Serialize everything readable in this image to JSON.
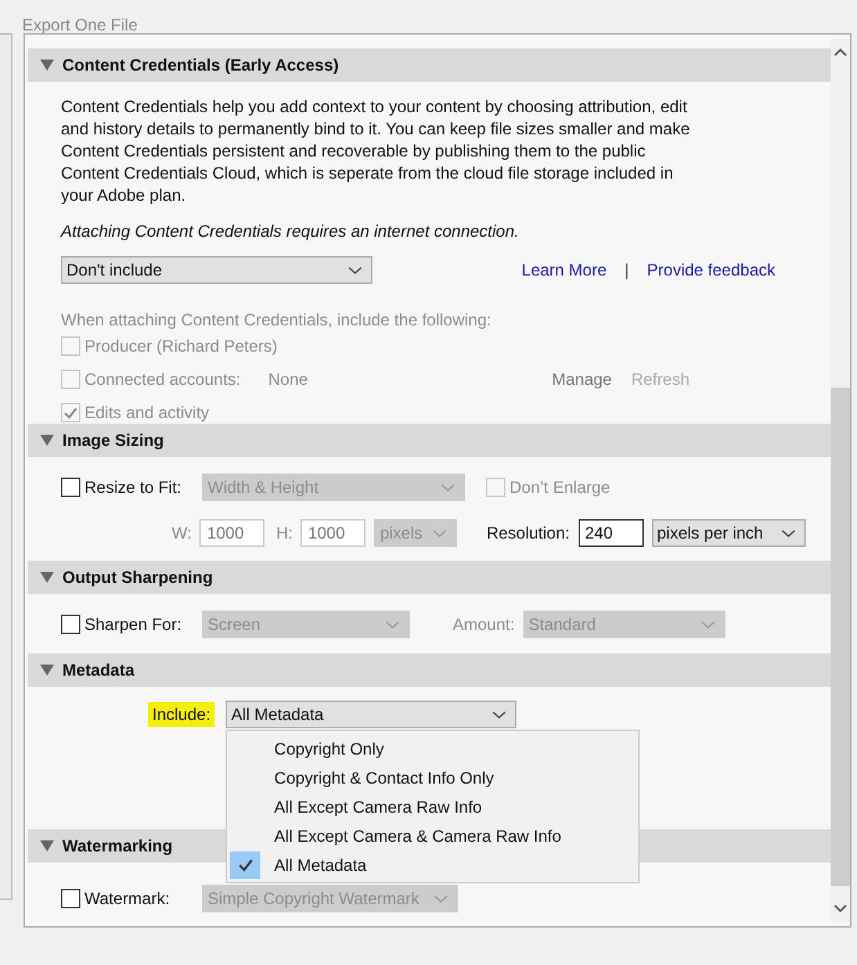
{
  "window": {
    "title": "Export One File"
  },
  "sections": [
    {
      "kind": "credentials",
      "title": "Content Credentials (Early Access)",
      "expanded": true,
      "description": "Content Credentials help you add context to your content by choosing attribution, edit and history details to permanently bind to it. You can keep file sizes smaller and make Content Credentials persistent and recoverable by publishing them to the public Content Credentials Cloud, which is seperate from the cloud file storage included in your Adobe plan.",
      "note": "Attaching Content Credentials requires an internet connection.",
      "mode": {
        "value": "Don't include"
      },
      "links": [
        "Learn More",
        "Provide feedback"
      ],
      "separator": "|",
      "include_label": "When attaching Content Credentials, include the following:",
      "options": [
        {
          "label": "Producer (Richard Peters)",
          "checked": false,
          "disabled": true
        },
        {
          "label": "Connected accounts:",
          "checked": false,
          "disabled": true,
          "value": "None"
        },
        {
          "label": "Edits and activity",
          "checked": true,
          "disabled": true
        }
      ],
      "buttons": [
        {
          "label": "Manage",
          "disabled": false
        },
        {
          "label": "Refresh",
          "disabled": true
        }
      ]
    },
    {
      "kind": "sizing",
      "title": "Image Sizing",
      "expanded": true,
      "resize": {
        "label": "Resize to Fit:",
        "checked": false,
        "value": "Width & Height",
        "disabled": true
      },
      "dont_enlarge": {
        "label": "Don’t Enlarge",
        "checked": false,
        "disabled": true
      },
      "width": {
        "label": "W:",
        "value": "1000",
        "disabled": true
      },
      "height": {
        "label": "H:",
        "value": "1000",
        "disabled": true
      },
      "units": {
        "value": "pixels",
        "disabled": true
      },
      "resolution": {
        "label": "Resolution:",
        "value": "240",
        "units": "pixels per inch"
      }
    },
    {
      "kind": "sharpening",
      "title": "Output Sharpening",
      "expanded": true,
      "sharpen": {
        "label": "Sharpen For:",
        "checked": false,
        "value": "Screen",
        "disabled": true
      },
      "amount": {
        "label": "Amount:",
        "value": "Standard",
        "disabled": true
      }
    },
    {
      "kind": "metadata",
      "title": "Metadata",
      "expanded": true,
      "include": {
        "label": "Include:",
        "value": "All Metadata",
        "highlighted": true
      },
      "menu": [
        {
          "label": "Copyright Only",
          "selected": false
        },
        {
          "label": "Copyright & Contact Info Only",
          "selected": false
        },
        {
          "label": "All Except Camera Raw Info",
          "selected": false
        },
        {
          "label": "All Except Camera & Camera Raw Info",
          "selected": false
        },
        {
          "label": "All Metadata",
          "selected": true
        }
      ]
    },
    {
      "kind": "watermarking",
      "title": "Watermarking",
      "expanded": true,
      "watermark": {
        "label": "Watermark:",
        "checked": false,
        "value": "Simple Copyright Watermark",
        "disabled": true
      }
    }
  ]
}
